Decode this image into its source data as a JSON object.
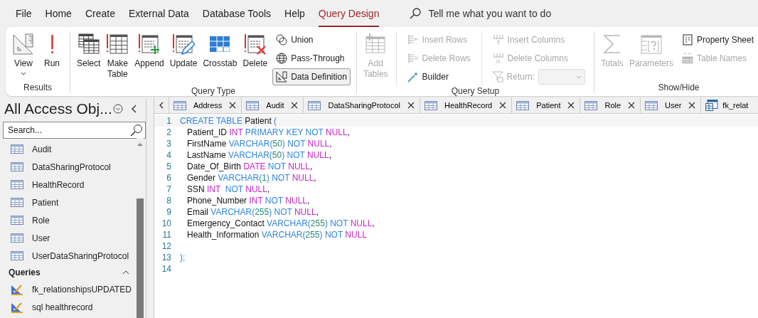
{
  "menu": {
    "tabs": [
      {
        "label": "File",
        "selected": false
      },
      {
        "label": "Home",
        "selected": false
      },
      {
        "label": "Create",
        "selected": false
      },
      {
        "label": "External Data",
        "selected": false
      },
      {
        "label": "Database Tools",
        "selected": false
      },
      {
        "label": "Help",
        "selected": false
      },
      {
        "label": "Query Design",
        "selected": true
      }
    ],
    "tell_me": {
      "placeholder": "Tell me what you want to do"
    }
  },
  "ribbon": {
    "groups": [
      {
        "label": "Results",
        "columns": [
          {
            "kind": "large",
            "items": [
              {
                "label": "View",
                "disabled": false
              }
            ]
          },
          {
            "kind": "large",
            "items": [
              {
                "label": "Run",
                "disabled": false
              }
            ]
          }
        ]
      },
      {
        "label": "Query Type",
        "columns": [
          {
            "kind": "large",
            "items": [
              {
                "label": "Select",
                "disabled": false
              }
            ]
          },
          {
            "kind": "large",
            "items": [
              {
                "label": "Make Table",
                "disabled": false
              }
            ]
          },
          {
            "kind": "large",
            "items": [
              {
                "label": "Append",
                "disabled": false
              }
            ]
          },
          {
            "kind": "large",
            "items": [
              {
                "label": "Update",
                "disabled": false
              }
            ]
          },
          {
            "kind": "large",
            "items": [
              {
                "label": "Crosstab",
                "disabled": false
              }
            ]
          },
          {
            "kind": "large",
            "items": [
              {
                "label": "Delete",
                "disabled": false
              }
            ]
          },
          {
            "kind": "stack",
            "items": [
              {
                "kind": "button",
                "label": "Union",
                "disabled": false,
                "selected": false
              },
              {
                "kind": "button",
                "label": "Pass-Through",
                "disabled": false,
                "selected": false
              },
              {
                "kind": "button",
                "label": "Data Definition",
                "disabled": false,
                "selected": true
              }
            ]
          }
        ]
      },
      {
        "label": "Query Setup",
        "columns": [
          {
            "kind": "large",
            "items": [
              {
                "label": "Add Tables",
                "disabled": true
              }
            ]
          },
          {
            "kind": "divider"
          },
          {
            "kind": "stack",
            "items": [
              {
                "kind": "button",
                "label": "Insert Rows",
                "disabled": true
              },
              {
                "kind": "button",
                "label": "Delete Rows",
                "disabled": true
              },
              {
                "kind": "button",
                "label": "Builder",
                "disabled": false
              }
            ]
          },
          {
            "kind": "divider"
          },
          {
            "kind": "stack",
            "items": [
              {
                "kind": "button",
                "label": "Insert Columns",
                "disabled": true
              },
              {
                "kind": "button",
                "label": "Delete Columns",
                "disabled": true
              },
              {
                "kind": "combo",
                "label": "Return:",
                "disabled": true
              }
            ]
          }
        ]
      },
      {
        "label": "Show/Hide",
        "columns": [
          {
            "kind": "large",
            "items": [
              {
                "label": "Totals",
                "disabled": true
              }
            ]
          },
          {
            "kind": "large",
            "items": [
              {
                "label": "Parameters",
                "disabled": true
              }
            ]
          },
          {
            "kind": "stack",
            "items": [
              {
                "kind": "button",
                "label": "Property Sheet",
                "disabled": false
              },
              {
                "kind": "button",
                "label": "Table Names",
                "disabled": true
              }
            ]
          }
        ]
      }
    ]
  },
  "nav": {
    "title": "All Access Obj...",
    "search": {
      "placeholder": "Search..."
    },
    "items": [
      {
        "kind": "table",
        "label": "Audit"
      },
      {
        "kind": "table",
        "label": "DataSharingProtocol"
      },
      {
        "kind": "table",
        "label": "HealthRecord"
      },
      {
        "kind": "table",
        "label": "Patient"
      },
      {
        "kind": "table",
        "label": "Role"
      },
      {
        "kind": "table",
        "label": "User"
      },
      {
        "kind": "table",
        "label": "UserDataSharingProtocol"
      },
      {
        "kind": "group",
        "label": "Queries",
        "expanded": true
      },
      {
        "kind": "query",
        "label": "fk_relationshipsUPDATED"
      },
      {
        "kind": "query",
        "label": "sql healthrecord"
      }
    ]
  },
  "doc_tabs": [
    {
      "kind": "table",
      "label": "Address"
    },
    {
      "kind": "table",
      "label": "Audit"
    },
    {
      "kind": "table",
      "label": "DataSharingProtocol"
    },
    {
      "kind": "table",
      "label": "HealthRecord"
    },
    {
      "kind": "table",
      "label": "Patient"
    },
    {
      "kind": "table",
      "label": "Role"
    },
    {
      "kind": "table",
      "label": "User"
    },
    {
      "kind": "query",
      "label": "fk_relat"
    }
  ],
  "code": {
    "lines": [
      {
        "number": "1",
        "tokens": [
          {
            "text": "CREATE TABLE ",
            "kind": "keyword"
          },
          {
            "text": "Patient ",
            "kind": "plain"
          },
          {
            "text": "(",
            "kind": "keyword"
          }
        ]
      },
      {
        "number": "2",
        "tokens": [
          {
            "text": "   Patient_ID ",
            "kind": "plain"
          },
          {
            "text": "INT",
            "kind": "type"
          },
          {
            "text": " PRIMARY KEY NOT ",
            "kind": "keyword"
          },
          {
            "text": "NULL",
            "kind": "type"
          },
          {
            "text": ",",
            "kind": "plain"
          }
        ]
      },
      {
        "number": "3",
        "tokens": [
          {
            "text": "   FirstName ",
            "kind": "plain"
          },
          {
            "text": "VARCHAR(",
            "kind": "keyword"
          },
          {
            "text": "50",
            "kind": "number"
          },
          {
            "text": ") NOT ",
            "kind": "keyword"
          },
          {
            "text": "NULL",
            "kind": "type"
          },
          {
            "text": ",",
            "kind": "plain"
          }
        ]
      },
      {
        "number": "4",
        "tokens": [
          {
            "text": "   LastName ",
            "kind": "plain"
          },
          {
            "text": "VARCHAR(",
            "kind": "keyword"
          },
          {
            "text": "50",
            "kind": "number"
          },
          {
            "text": ") NOT ",
            "kind": "keyword"
          },
          {
            "text": "NULL",
            "kind": "type"
          },
          {
            "text": ",",
            "kind": "plain"
          }
        ]
      },
      {
        "number": "5",
        "tokens": [
          {
            "text": "   Date_Of_Birth ",
            "kind": "plain"
          },
          {
            "text": "DATE",
            "kind": "type"
          },
          {
            "text": " NOT ",
            "kind": "keyword"
          },
          {
            "text": "NULL",
            "kind": "type"
          },
          {
            "text": ",",
            "kind": "plain"
          }
        ]
      },
      {
        "number": "6",
        "tokens": [
          {
            "text": "   Gender ",
            "kind": "plain"
          },
          {
            "text": "VARCHAR(",
            "kind": "keyword"
          },
          {
            "text": "1",
            "kind": "number"
          },
          {
            "text": ") NOT ",
            "kind": "keyword"
          },
          {
            "text": "NULL",
            "kind": "type"
          },
          {
            "text": ",",
            "kind": "plain"
          }
        ]
      },
      {
        "number": "7",
        "tokens": [
          {
            "text": "   SSN ",
            "kind": "plain"
          },
          {
            "text": "INT",
            "kind": "type"
          },
          {
            "text": "  NOT ",
            "kind": "keyword"
          },
          {
            "text": "NULL",
            "kind": "type"
          },
          {
            "text": ",",
            "kind": "plain"
          }
        ]
      },
      {
        "number": "8",
        "tokens": [
          {
            "text": "   Phone_Number ",
            "kind": "plain"
          },
          {
            "text": "INT",
            "kind": "type"
          },
          {
            "text": " NOT ",
            "kind": "keyword"
          },
          {
            "text": "NULL",
            "kind": "type"
          },
          {
            "text": ",",
            "kind": "plain"
          }
        ]
      },
      {
        "number": "9",
        "tokens": [
          {
            "text": "   Email ",
            "kind": "plain"
          },
          {
            "text": "VARCHAR(",
            "kind": "keyword"
          },
          {
            "text": "255",
            "kind": "number"
          },
          {
            "text": ") NOT ",
            "kind": "keyword"
          },
          {
            "text": "NULL",
            "kind": "type"
          },
          {
            "text": ",",
            "kind": "plain"
          }
        ]
      },
      {
        "number": "10",
        "tokens": [
          {
            "text": "   Emergency_Contact ",
            "kind": "plain"
          },
          {
            "text": "VARCHAR(",
            "kind": "keyword"
          },
          {
            "text": "255",
            "kind": "number"
          },
          {
            "text": ") NOT ",
            "kind": "keyword"
          },
          {
            "text": "NULL",
            "kind": "type"
          },
          {
            "text": ",",
            "kind": "plain"
          }
        ]
      },
      {
        "number": "11",
        "tokens": [
          {
            "text": "   Health_Information ",
            "kind": "plain"
          },
          {
            "text": "VARCHAR(",
            "kind": "keyword"
          },
          {
            "text": "255",
            "kind": "number"
          },
          {
            "text": ") NOT ",
            "kind": "keyword"
          },
          {
            "text": "NULL",
            "kind": "type"
          }
        ]
      },
      {
        "number": "12"
      },
      {
        "number": "13",
        "tokens": [
          {
            "text": ");",
            "kind": "keyword"
          }
        ]
      },
      {
        "number": "14"
      }
    ]
  }
}
